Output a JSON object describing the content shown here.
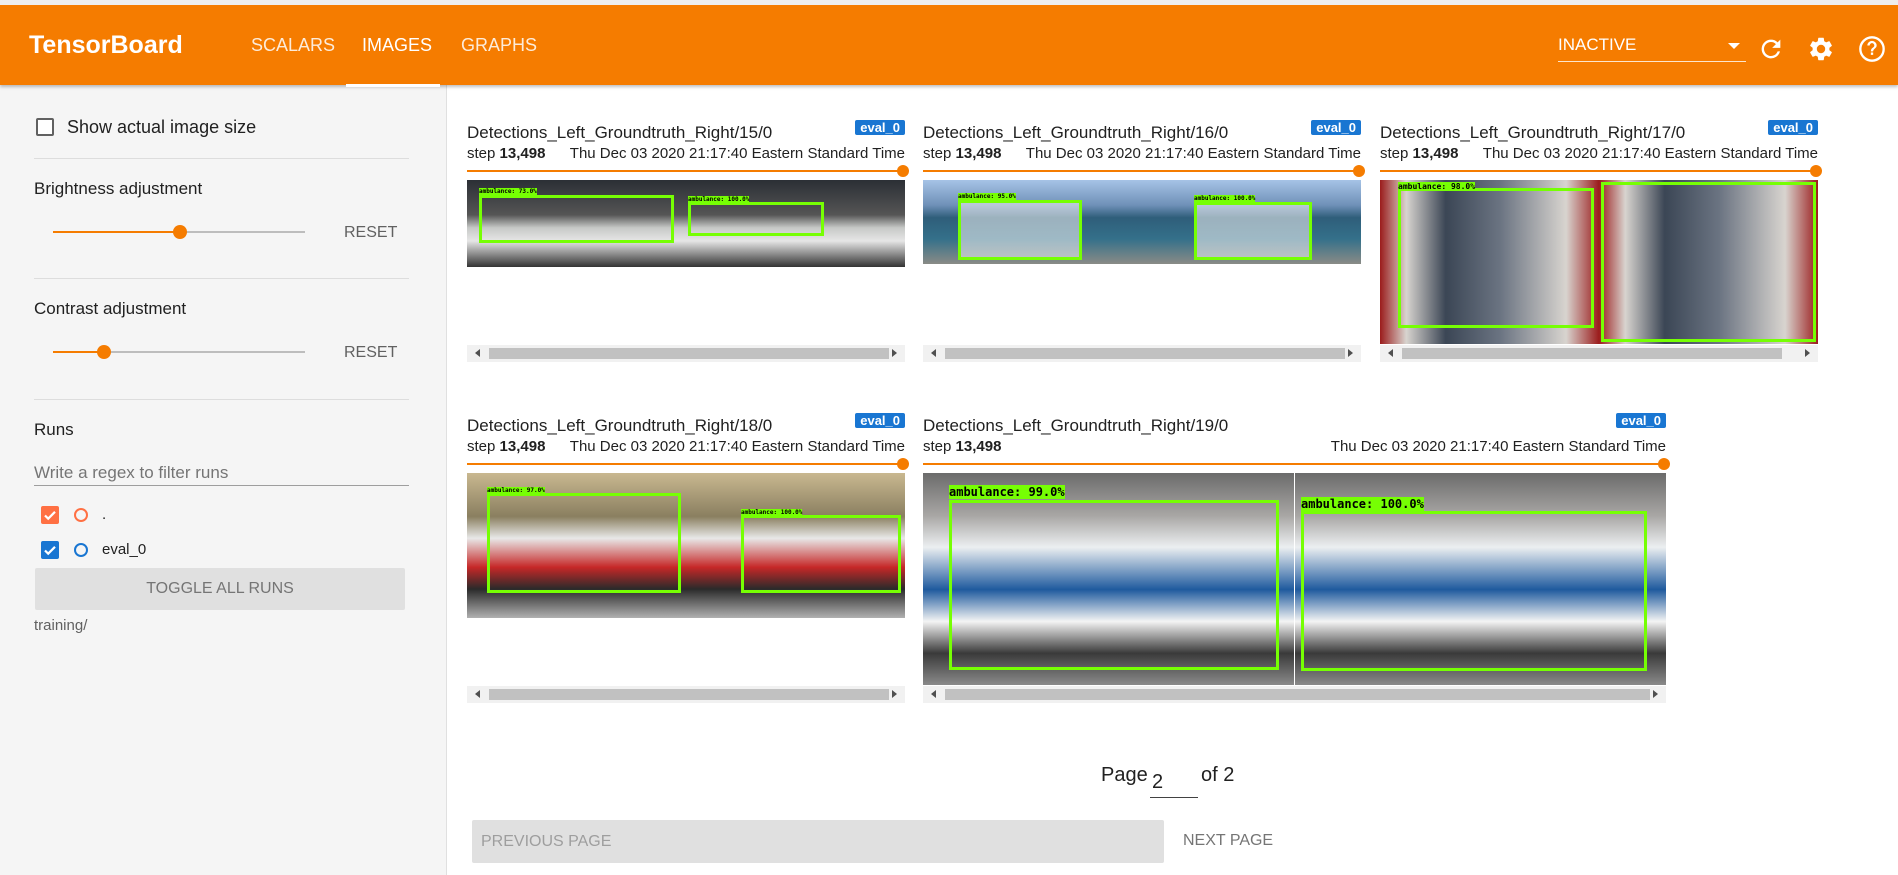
{
  "header": {
    "brand": "TensorBoard",
    "tabs": [
      {
        "label": "SCALARS"
      },
      {
        "label": "IMAGES"
      },
      {
        "label": "GRAPHS"
      }
    ],
    "run_select_value": "INACTIVE",
    "icons": [
      "refresh-icon",
      "settings-icon",
      "help-icon"
    ]
  },
  "sidebar": {
    "show_actual_size_label": "Show actual image size",
    "brightness": {
      "label": "Brightness adjustment",
      "reset": "RESET",
      "value": 0.5
    },
    "contrast": {
      "label": "Contrast adjustment",
      "reset": "RESET",
      "value": 0.2
    },
    "runs": {
      "title": "Runs",
      "filter_placeholder": "Write a regex to filter runs",
      "items": [
        {
          "name": ".",
          "color": "#ff7043",
          "checked": true
        },
        {
          "name": "eval_0",
          "color": "#1976d2",
          "checked": true
        }
      ],
      "toggle_all": "TOGGLE ALL RUNS",
      "footer": "training/"
    }
  },
  "cards": [
    {
      "title": "Detections_Left_Groundtruth_Right/15/0",
      "run": "eval_0",
      "step_label": "step",
      "step": "13,498",
      "time": "Thu Dec 03 2020 21:17:40 Eastern Standard Time",
      "det_left": "ambulance: 73.0%",
      "det_right": "ambulance: 100.0%"
    },
    {
      "title": "Detections_Left_Groundtruth_Right/16/0",
      "run": "eval_0",
      "step_label": "step",
      "step": "13,498",
      "time": "Thu Dec 03 2020 21:17:40 Eastern Standard Time",
      "det_left": "ambulance: 95.0%",
      "det_right": "ambulance: 100.0%"
    },
    {
      "title": "Detections_Left_Groundtruth_Right/17/0",
      "run": "eval_0",
      "step_label": "step",
      "step": "13,498",
      "time": "Thu Dec 03 2020 21:17:40 Eastern Standard Time",
      "det_left": "ambulance: 98.0%",
      "det_right": ""
    },
    {
      "title": "Detections_Left_Groundtruth_Right/18/0",
      "run": "eval_0",
      "step_label": "step",
      "step": "13,498",
      "time": "Thu Dec 03 2020 21:17:40 Eastern Standard Time",
      "det_left": "ambulance: 97.0%",
      "det_right": "ambulance: 100.0%"
    },
    {
      "title": "Detections_Left_Groundtruth_Right/19/0",
      "run": "eval_0",
      "step_label": "step",
      "step": "13,498",
      "time": "Thu Dec 03 2020 21:17:40 Eastern Standard Time",
      "det_left": "ambulance: 99.0%",
      "det_right": "ambulance: 100.0%"
    }
  ],
  "pagination": {
    "page_label": "Page",
    "current_page": "2",
    "of_label": "of 2",
    "prev": "PREVIOUS PAGE",
    "next": "NEXT PAGE"
  },
  "colors": {
    "accent": "#f57c00",
    "badge": "#1976d2",
    "detection_box": "#76ff03"
  }
}
